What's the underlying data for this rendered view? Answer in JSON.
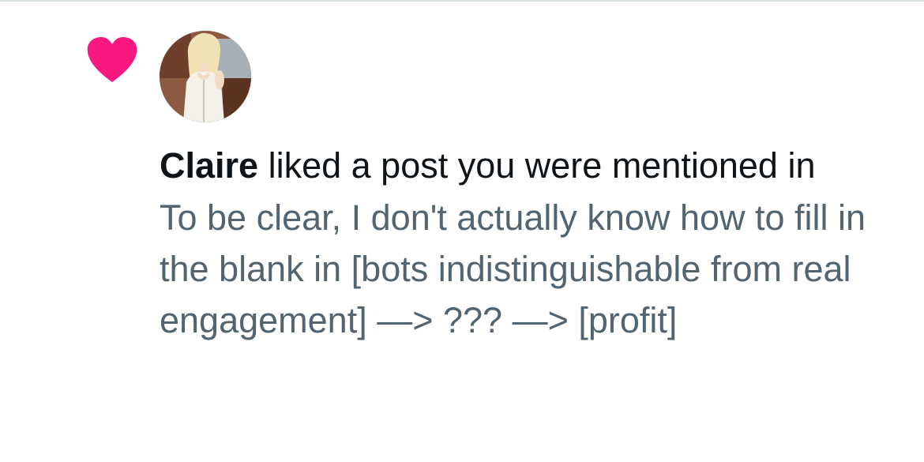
{
  "notification": {
    "type_icon": "heart-icon",
    "icon_color": "#f91880",
    "avatar_alt": "Claire",
    "user_name": "Claire",
    "action_text": " liked a post you were mentioned in",
    "post_text": "To be clear, I don't actually know how to fill in the blank in  [bots indistinguishable from real engagement] —> ??? —> [profit]"
  },
  "colors": {
    "primary_text": "#0f1419",
    "secondary_text": "#536471",
    "like": "#f91880",
    "divider": "#d8e0e4"
  }
}
